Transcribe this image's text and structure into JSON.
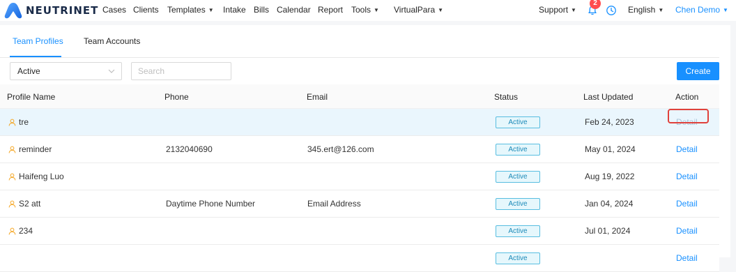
{
  "brand": {
    "name": "NEUTRINET"
  },
  "nav": {
    "items": [
      {
        "label": "Cases",
        "dropdown": false
      },
      {
        "label": "Clients",
        "dropdown": false
      },
      {
        "label": "Templates",
        "dropdown": true
      },
      {
        "label": "Intake",
        "dropdown": false
      },
      {
        "label": "Bills",
        "dropdown": false
      },
      {
        "label": "Calendar",
        "dropdown": false
      },
      {
        "label": "Report",
        "dropdown": false
      },
      {
        "label": "Tools",
        "dropdown": true
      },
      {
        "label": "VirtualPara",
        "dropdown": true
      }
    ],
    "support_label": "Support",
    "notification_count": "2",
    "language_label": "English",
    "user_label": "Chen Demo"
  },
  "tabs": [
    {
      "label": "Team Profiles",
      "active": true
    },
    {
      "label": "Team Accounts",
      "active": false
    }
  ],
  "filters": {
    "status_selected": "Active",
    "search_placeholder": "Search",
    "create_label": "Create"
  },
  "table": {
    "columns": [
      "Profile Name",
      "Phone",
      "Email",
      "Status",
      "Last Updated",
      "Action"
    ],
    "rows": [
      {
        "name": "tre",
        "phone": "",
        "email": "",
        "status": "Active",
        "updated": "Feb 24, 2023",
        "action": "Detail",
        "highlighted": true
      },
      {
        "name": "reminder",
        "phone": "2132040690",
        "email": "345.ert@126.com",
        "status": "Active",
        "updated": "May 01, 2024",
        "action": "Detail",
        "highlighted": false
      },
      {
        "name": "Haifeng Luo",
        "phone": "",
        "email": "",
        "status": "Active",
        "updated": "Aug 19, 2022",
        "action": "Detail",
        "highlighted": false
      },
      {
        "name": "S2 att",
        "phone": "Daytime Phone Number",
        "email": "Email Address",
        "status": "Active",
        "updated": "Jan 04, 2024",
        "action": "Detail",
        "highlighted": false
      },
      {
        "name": "234",
        "phone": "",
        "email": "",
        "status": "Active",
        "updated": "Jul 01, 2024",
        "action": "Detail",
        "highlighted": false
      },
      {
        "name": "",
        "phone": "",
        "email": "",
        "status": "Active",
        "updated": "",
        "action": "Detail",
        "highlighted": false
      }
    ]
  },
  "colors": {
    "accent": "#1890ff",
    "row_highlight": "#eaf6fd",
    "status_tag_border": "#57bde0",
    "annotation_box": "#e0413b"
  },
  "icons": [
    "logo-mark-icon",
    "bell-icon",
    "clock-icon",
    "chevron-down-icon",
    "user-icon"
  ]
}
